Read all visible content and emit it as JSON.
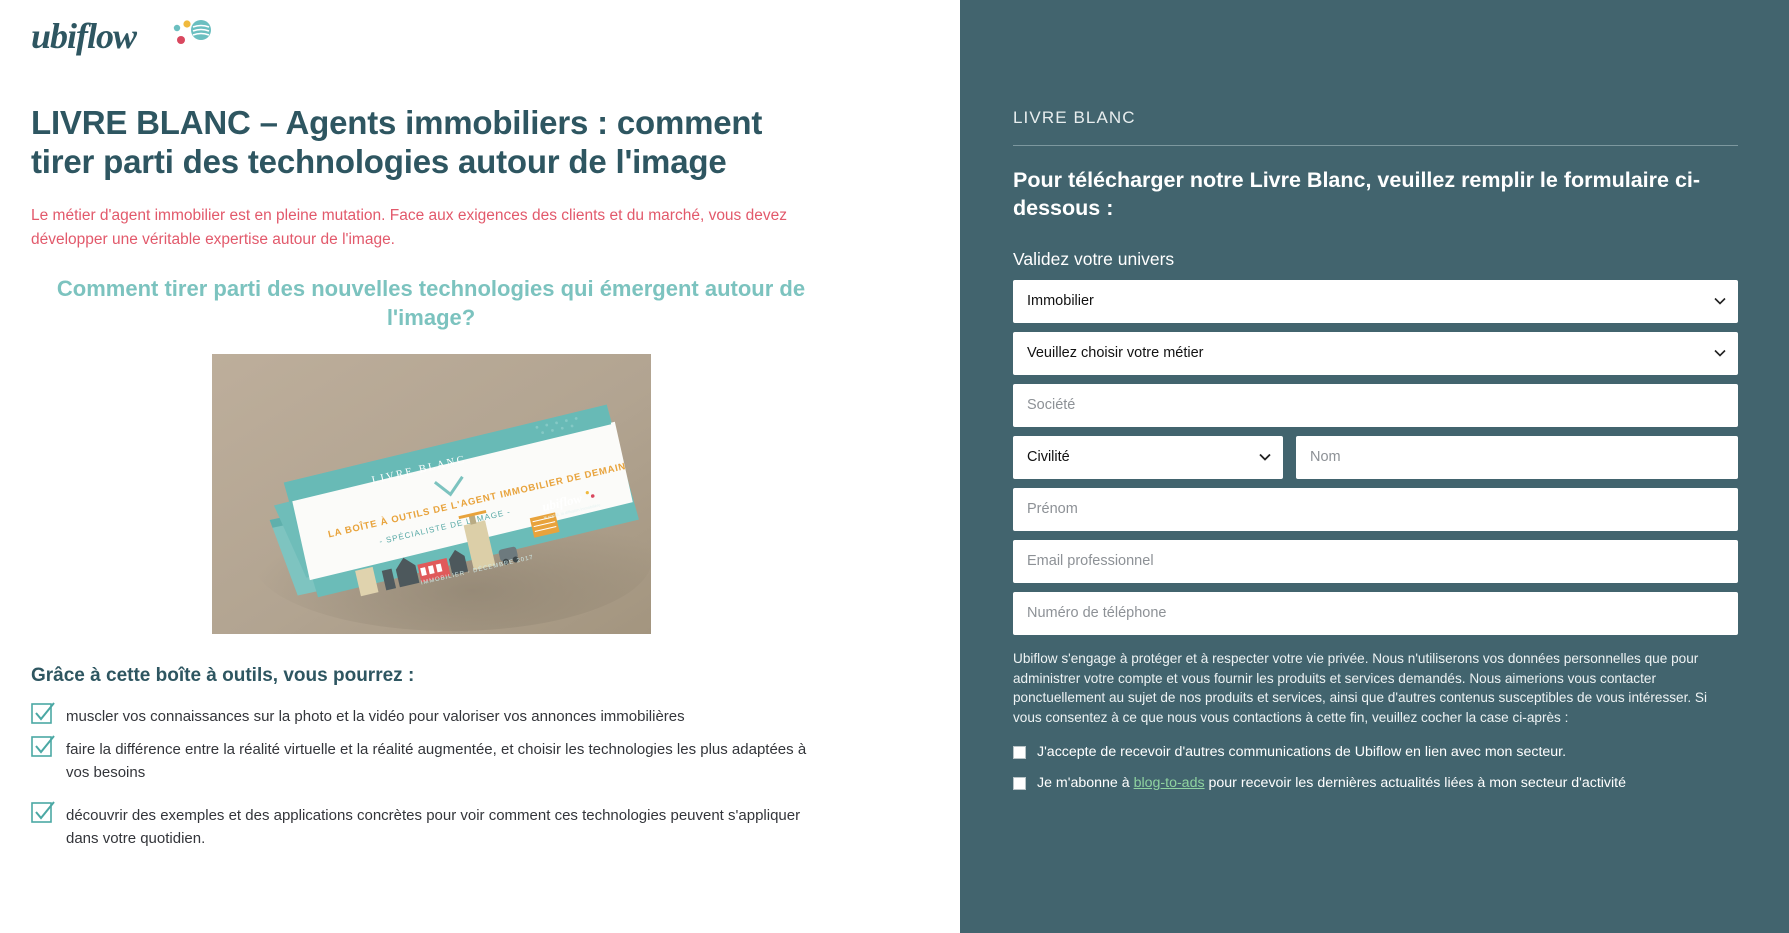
{
  "brand": {
    "logo_text": "ubiflow",
    "logo_color": "#2e5661",
    "accent_teal": "#7cc3bf",
    "accent_coral": "#e2596b",
    "panel_bg": "#42646e"
  },
  "left": {
    "title": "LIVRE BLANC – Agents immobiliers : comment tirer parti des technologies autour de l'image",
    "intro": "Le métier d'agent immobilier est en pleine mutation. Face aux exigences des clients et du marché, vous devez développer une véritable expertise autour de l'image.",
    "subheading": "Comment tirer parti des nouvelles technologies qui émergent autour de l'image?",
    "book_cover": {
      "kicker": "LIVRE BLANC",
      "title": "LA BOÎTE À OUTILS DE L'AGENT IMMOBILIER DE DEMAIN",
      "subtitle": "- SPÉCIALISTE DE L'IMAGE -",
      "logo": "ubiflow",
      "footer": "IMMOBILIER - DÉCEMBRE 2017"
    },
    "list_title": "Grâce à cette boîte à outils, vous pourrez :",
    "list_items": [
      "muscler vos connaissances sur la photo et la vidéo pour valoriser vos annonces immobilières",
      "faire la différence entre la réalité virtuelle et la réalité augmentée, et choisir les technologies les plus adaptées à vos besoins",
      "découvrir des exemples et des applications concrètes pour voir comment ces technologies peuvent s'appliquer dans votre quotidien."
    ]
  },
  "form": {
    "kicker": "LIVRE BLANC",
    "heading": "Pour télécharger notre Livre Blanc, veuillez remplir le formulaire ci-dessous :",
    "univers_label": "Validez votre univers",
    "univers_value": "Immobilier",
    "metier_value": "Veuillez choisir votre métier",
    "societe_placeholder": "Société",
    "civilite_value": "Civilité",
    "nom_placeholder": "Nom",
    "prenom_placeholder": "Prénom",
    "email_placeholder": "Email professionnel",
    "telephone_placeholder": "Numéro de téléphone",
    "privacy": "Ubiflow s'engage à protéger et à respecter votre vie privée. Nous n'utiliserons vos données personnelles que pour administrer votre compte et vous fournir les produits et services demandés. Nous aimerions vous contacter ponctuellement au sujet de nos produits et services, ainsi que d'autres contenus susceptibles de vous intéresser. Si vous consentez à ce que nous vous contactions à cette fin, veuillez cocher la case ci-après :",
    "consent_1": "J'accepte de recevoir d'autres communications de Ubiflow en lien avec mon secteur.",
    "consent_2_pre": "Je m'abonne à ",
    "consent_2_link": "blog-to-ads",
    "consent_2_post": " pour recevoir les dernières actualités liées à mon secteur d'activité"
  }
}
